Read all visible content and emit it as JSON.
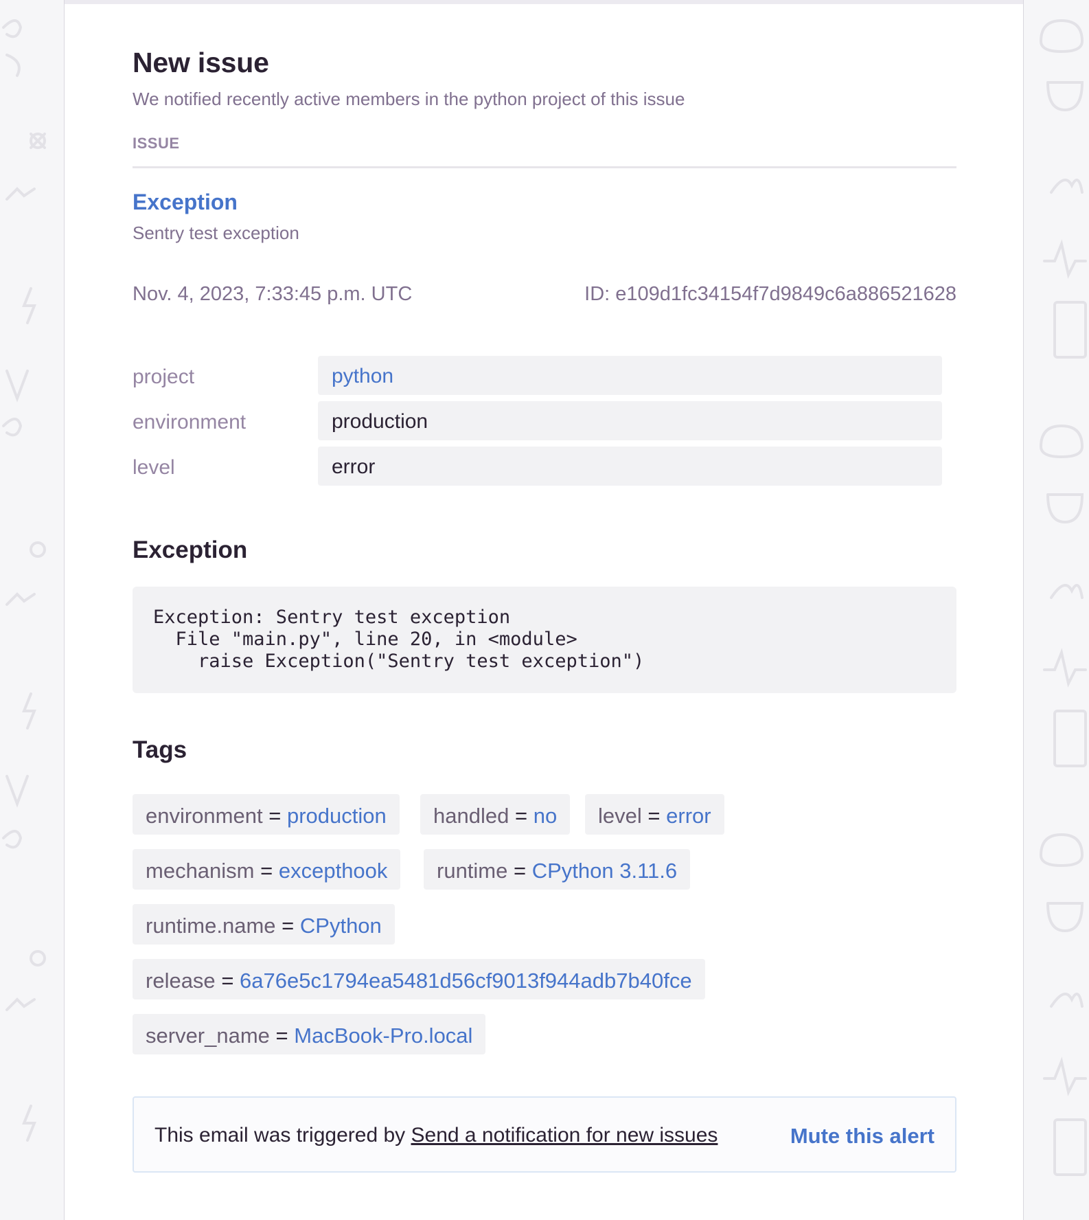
{
  "email": {
    "title": "New issue",
    "subtitle": "We notified recently active members in the python project of this issue",
    "section_label": "ISSUE"
  },
  "issue": {
    "title": "Exception",
    "subtitle": "Sentry test exception",
    "date": "Nov. 4, 2023, 7:33:45 p.m. UTC",
    "id": "ID: e109d1fc34154f7d9849c6a886521628"
  },
  "details": [
    {
      "key": "project",
      "value": "python"
    },
    {
      "key": "environment",
      "value": "production"
    },
    {
      "key": "level",
      "value": "error"
    }
  ],
  "exception": {
    "heading": "Exception",
    "stacktrace": "Exception: Sentry test exception\n  File \"main.py\", line 20, in <module>\n    raise Exception(\"Sentry test exception\")"
  },
  "tags": {
    "heading": "Tags",
    "separator": "=",
    "items": [
      {
        "key": "environment",
        "value": "production"
      },
      {
        "key": "handled",
        "value": "no"
      },
      {
        "key": "level",
        "value": "error"
      },
      {
        "key": "mechanism",
        "value": "excepthook"
      },
      {
        "key": "runtime",
        "value": "CPython 3.11.6"
      },
      {
        "key": "runtime.name",
        "value": "CPython"
      },
      {
        "key": "release",
        "value": "6a76e5c1794ea5481d56cf9013f944adb7b40fce"
      },
      {
        "key": "server_name",
        "value": "MacBook-Pro.local"
      }
    ]
  },
  "footer": {
    "prefix": "This email was triggered by",
    "rule_link": "Send a notification for new issues",
    "mute_link": "Mute this alert"
  },
  "colors": {
    "link": "#4674ca",
    "muted": "#80708f",
    "text": "#2b2233"
  }
}
